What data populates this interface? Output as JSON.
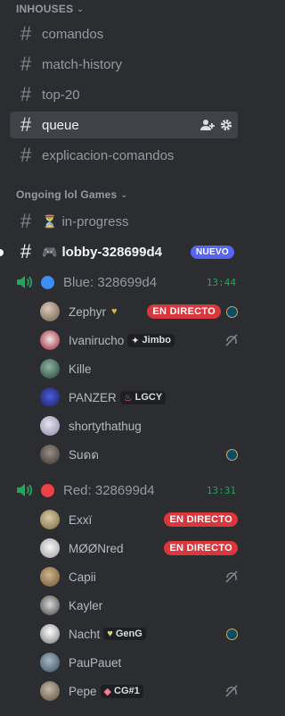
{
  "categories": {
    "inhouses": "INHOUSES",
    "ongoing": "Ongoing lol Games"
  },
  "channels": [
    {
      "label": "comandos"
    },
    {
      "label": "match-history"
    },
    {
      "label": "top-20"
    },
    {
      "label": "queue"
    },
    {
      "label": "explicacion-comandos"
    }
  ],
  "ongoing_channels": {
    "in_progress": {
      "emoji": "⏳",
      "label": "in-progress"
    },
    "lobby": {
      "emoji": "🎮",
      "label": "lobby-328699d4",
      "badge": "NUEVO"
    }
  },
  "voice": {
    "blue": {
      "label": "Blue: 328699d4",
      "timer": "13:44",
      "color": "#3c8ef5"
    },
    "red": {
      "label": "Red: 328699d4",
      "timer": "13:31",
      "color": "#ed4245"
    }
  },
  "live_label": "EN DIRECTO",
  "blue_members": [
    {
      "name": "Zephyr",
      "tag": "",
      "live": true,
      "lol": true,
      "deafened": false
    },
    {
      "name": "Ivanirucho",
      "tag": "Jimbo",
      "live": false,
      "lol": false,
      "deafened": true
    },
    {
      "name": "Kille",
      "tag": "",
      "live": false,
      "lol": false,
      "deafened": false
    },
    {
      "name": "PANZER",
      "tag": "LGCY",
      "live": false,
      "lol": false,
      "deafened": false
    },
    {
      "name": "shortythathug",
      "tag": "",
      "live": false,
      "lol": false,
      "deafened": false
    },
    {
      "name": "Suดด",
      "tag": "",
      "live": false,
      "lol": true,
      "deafened": false
    }
  ],
  "red_members": [
    {
      "name": "Exxï",
      "tag": "",
      "live": true,
      "lol": false,
      "deafened": false
    },
    {
      "name": "MØØNred",
      "tag": "",
      "live": true,
      "lol": false,
      "deafened": false
    },
    {
      "name": "Capii",
      "tag": "",
      "live": false,
      "lol": false,
      "deafened": true
    },
    {
      "name": "Kayler",
      "tag": "",
      "live": false,
      "lol": false,
      "deafened": false
    },
    {
      "name": "Nacht",
      "tag": "GenG",
      "live": false,
      "lol": true,
      "deafened": false
    },
    {
      "name": "PauPauet",
      "tag": "",
      "live": false,
      "lol": false,
      "deafened": false
    },
    {
      "name": "Pepe",
      "tag": "CG#1",
      "live": false,
      "lol": false,
      "deafened": true
    }
  ]
}
